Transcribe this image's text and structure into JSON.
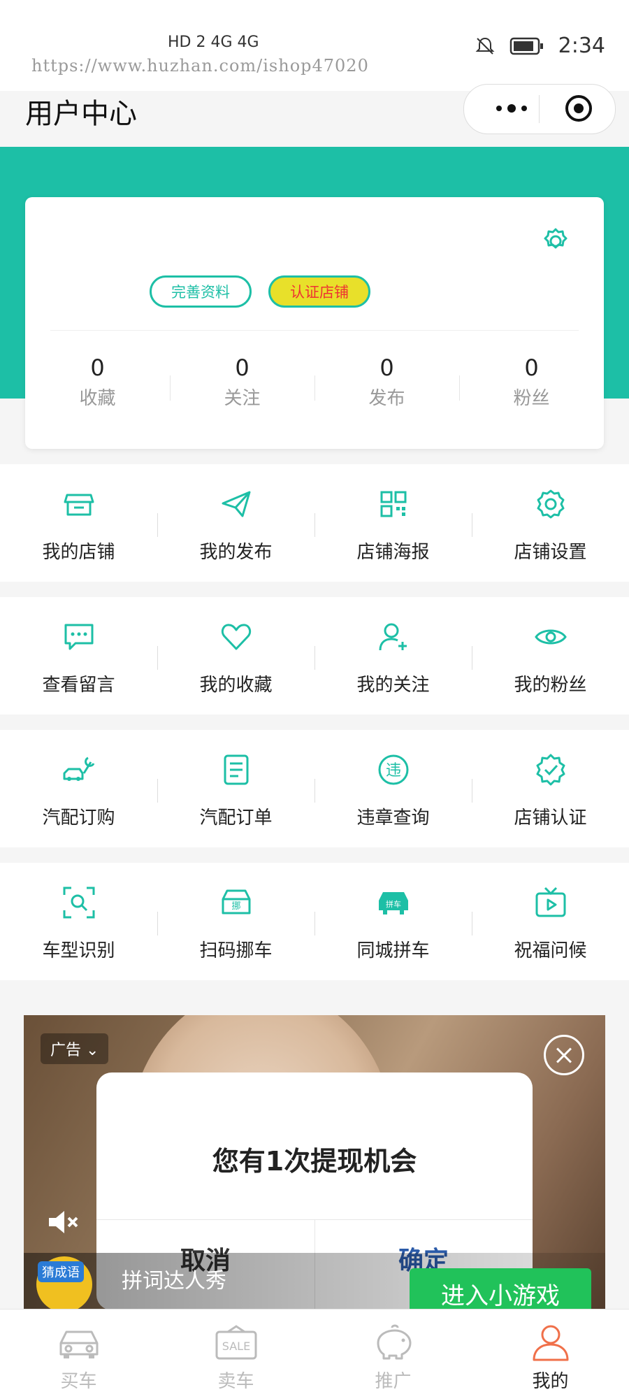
{
  "status_bar": {
    "network": "HD 2 4G 4G",
    "time": "2:34"
  },
  "watermark": "https://www.huzhan.com/ishop47020",
  "header": {
    "title": "用户中心"
  },
  "profile": {
    "buttons": [
      "完善资料",
      "认证店铺"
    ],
    "stats": [
      {
        "value": "0",
        "label": "收藏"
      },
      {
        "value": "0",
        "label": "关注"
      },
      {
        "value": "0",
        "label": "发布"
      },
      {
        "value": "0",
        "label": "粉丝"
      }
    ]
  },
  "grid_rows": [
    [
      {
        "label": "我的店铺",
        "icon": "store-icon"
      },
      {
        "label": "我的发布",
        "icon": "send-icon"
      },
      {
        "label": "店铺海报",
        "icon": "qrcode-icon"
      },
      {
        "label": "店铺设置",
        "icon": "gear-icon"
      }
    ],
    [
      {
        "label": "查看留言",
        "icon": "message-icon"
      },
      {
        "label": "我的收藏",
        "icon": "heart-icon"
      },
      {
        "label": "我的关注",
        "icon": "user-plus-icon"
      },
      {
        "label": "我的粉丝",
        "icon": "eye-icon"
      }
    ],
    [
      {
        "label": "汽配订购",
        "icon": "car-repair-icon"
      },
      {
        "label": "汽配订单",
        "icon": "document-icon"
      },
      {
        "label": "违章查询",
        "icon": "violation-icon"
      },
      {
        "label": "店铺认证",
        "icon": "verified-badge-icon"
      }
    ],
    [
      {
        "label": "车型识别",
        "icon": "scan-search-icon"
      },
      {
        "label": "扫码挪车",
        "icon": "move-car-icon"
      },
      {
        "label": "同城拼车",
        "icon": "carpool-icon"
      },
      {
        "label": "祝福问候",
        "icon": "video-tv-icon"
      }
    ]
  ],
  "ad": {
    "tag": "广告",
    "dialog": {
      "title": "您有1次提现机会",
      "cancel": "取消",
      "confirm": "确定"
    },
    "game_avatar_tag": "猜成语",
    "game_name": "拼词达人秀",
    "cta": "进入小游戏"
  },
  "tabbar": [
    {
      "label": "买车",
      "icon": "car-icon",
      "active": false
    },
    {
      "label": "卖车",
      "icon": "sale-icon",
      "active": false
    },
    {
      "label": "推广",
      "icon": "piggy-bank-icon",
      "active": false
    },
    {
      "label": "我的",
      "icon": "user-icon",
      "active": true
    }
  ],
  "colors": {
    "accent": "#1dbfa6",
    "highlight": "#e8e02a",
    "cta_green": "#21c25a",
    "confirm_blue": "#2a5aa8"
  }
}
